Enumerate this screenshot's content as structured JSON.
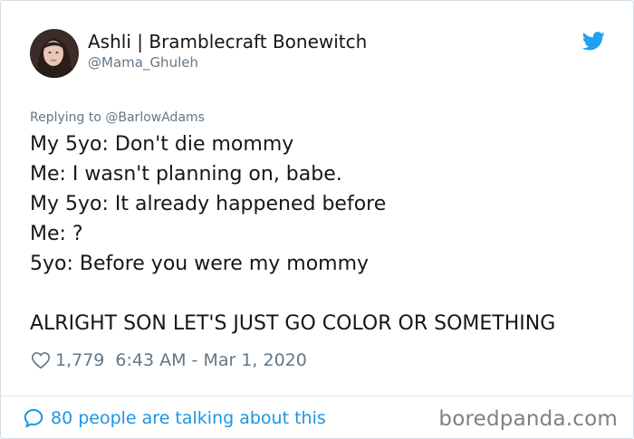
{
  "author": {
    "display_name": "Ashli | Bramblecraft Bonewitch",
    "handle": "@Mama_Ghuleh",
    "avatar_icon": "profile-photo"
  },
  "brand": {
    "logo_icon": "twitter-bird-icon",
    "accent_color": "#1da1f2"
  },
  "tweet": {
    "replying_to": "Replying to @BarlowAdams",
    "lines": [
      "My 5yo: Don't die mommy",
      "Me: I wasn't planning on, babe.",
      "My 5yo: It already happened before",
      "Me: ?",
      "5yo: Before you were my mommy",
      "",
      "ALRIGHT SON LET'S JUST GO COLOR OR SOMETHING"
    ],
    "likes": "1,779",
    "timestamp": "6:43 AM - Mar 1, 2020"
  },
  "footer": {
    "talking_text": "80 people are talking about this",
    "link_color": "#1b95e0"
  },
  "watermark": {
    "text": "boredpanda.com"
  }
}
